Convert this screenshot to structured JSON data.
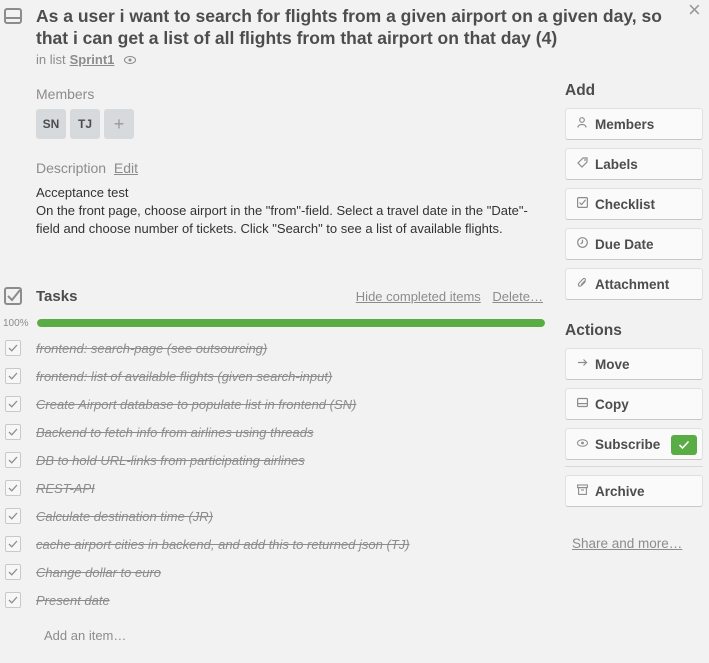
{
  "card": {
    "title": "As a user i want to search for flights from a given airport on a given day, so that i can get a list of all flights from that airport on that day (4)",
    "in_list_prefix": "in list",
    "list_name": "Sprint1"
  },
  "members": {
    "label": "Members",
    "avatars": [
      "SN",
      "TJ"
    ],
    "add": "+"
  },
  "description": {
    "label": "Description",
    "edit": "Edit",
    "line1": "Acceptance test",
    "line2": "On the front page, choose airport in the \"from\"-field. Select a travel date in the \"Date\"-field and choose number of tickets. Click \"Search\" to see a list of available flights."
  },
  "tasks": {
    "title": "Tasks",
    "hide_completed": "Hide completed items",
    "delete": "Delete…",
    "progress_label": "100%",
    "progress_percent": 100,
    "items": [
      "frontend: search-page (see outsourcing)",
      "frontend: list of available flights (given search-input)",
      "Create Airport database to populate list in frontend (SN)",
      "Backend to fetch info from airlines using threads",
      "DB to hold URL-links from participating airlines",
      "REST-API",
      "Calculate destination time (JR)",
      "cache airport cities in backend, and add this to returned json (TJ)",
      "Change dollar to euro",
      "Present date"
    ],
    "add_item": "Add an item…"
  },
  "sidebar": {
    "add_title": "Add",
    "add_buttons": [
      {
        "label": "Members",
        "icon": "person-icon"
      },
      {
        "label": "Labels",
        "icon": "tag-icon"
      },
      {
        "label": "Checklist",
        "icon": "checklist-icon"
      },
      {
        "label": "Due Date",
        "icon": "clock-icon"
      },
      {
        "label": "Attachment",
        "icon": "paperclip-icon"
      }
    ],
    "actions_title": "Actions",
    "action_buttons": [
      {
        "label": "Move",
        "icon": "arrow-right-icon"
      },
      {
        "label": "Copy",
        "icon": "card-icon"
      },
      {
        "label": "Subscribe",
        "icon": "eye-icon"
      },
      {
        "label": "Archive",
        "icon": "archive-icon"
      }
    ],
    "share": "Share and more…"
  },
  "colors": {
    "progress": "#5aac44",
    "subscribe_check": "#5aac44"
  }
}
